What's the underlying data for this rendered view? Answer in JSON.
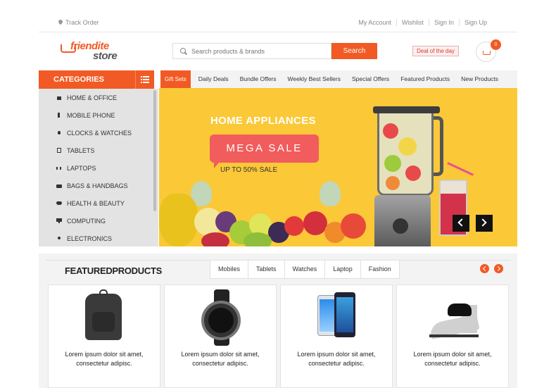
{
  "topbar": {
    "track_order": "Track Order",
    "links": [
      "My Account",
      "Wishlist",
      "Sign In",
      "Sign Up"
    ]
  },
  "header": {
    "logo_line1": "friendite",
    "logo_line2": "store",
    "search_placeholder": "Search products & brands",
    "search_button": "Search",
    "deal_label": "Deal of the day",
    "cart_count": "0"
  },
  "categories": {
    "title": "CATEGORIES",
    "items": [
      {
        "label": "HOME & OFFICE",
        "icon": "home-icon"
      },
      {
        "label": "MOBILE PHONE",
        "icon": "mobile-icon"
      },
      {
        "label": "CLOCKS & WATCHES",
        "icon": "watch-icon"
      },
      {
        "label": "TABLETS",
        "icon": "tablet-icon"
      },
      {
        "label": "LAPTOPS",
        "icon": "laptop-icon"
      },
      {
        "label": "BAGS & HANDBAGS",
        "icon": "bag-icon"
      },
      {
        "label": "HEALTH & BEAUTY",
        "icon": "heart-icon"
      },
      {
        "label": "COMPUTING",
        "icon": "monitor-icon"
      },
      {
        "label": "ELECTRONICS",
        "icon": "bulb-icon"
      }
    ]
  },
  "nav": {
    "tabs": [
      "Gift Sets",
      "Daily Deals",
      "Bundle Offers",
      "Weekly Best Sellers",
      "Special Offers",
      "Featured Products",
      "New Products"
    ],
    "active_index": 0
  },
  "banner": {
    "title": "HOME APPLIANCES",
    "badge": "MEGA SALE",
    "subtitle": "UP TO 50% SALE"
  },
  "featured": {
    "title": "FEATUREDPRODUCTS",
    "tabs": [
      "Mobiles",
      "Tablets",
      "Watches",
      "Laptop",
      "Fashion"
    ],
    "products": [
      {
        "image": "backpack",
        "line1": "Lorem ipsum dolor sit amet,",
        "line2": "consectetur adipisc."
      },
      {
        "image": "wristwatch",
        "line1": "Lorem ipsum dolor sit amet,",
        "line2": "consectetur adipisc."
      },
      {
        "image": "smartphones",
        "line1": "Lorem ipsum dolor sit amet,",
        "line2": "consectetur adipisc."
      },
      {
        "image": "wedge-sandal",
        "line1": "Lorem ipsum dolor sit amet,",
        "line2": "consectetur adipisc."
      }
    ]
  },
  "colors": {
    "accent": "#f15a24",
    "banner_bg": "#fbc837",
    "mega_sale": "#f15c5c"
  }
}
